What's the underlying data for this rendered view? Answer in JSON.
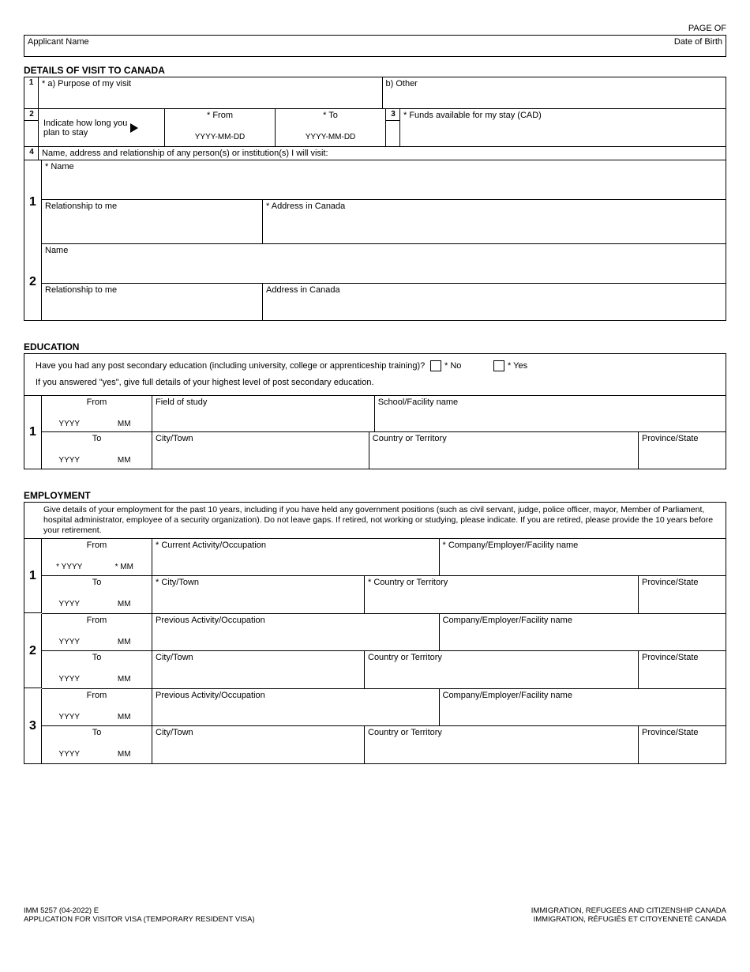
{
  "page_label": "PAGE  OF",
  "header": {
    "applicant_name": "Applicant Name",
    "dob": "Date of Birth"
  },
  "visit": {
    "title": "DETAILS OF VISIT TO CANADA",
    "n1": "1",
    "purpose": "* a) Purpose of my visit",
    "other": "b) Other",
    "n2": "2",
    "indicate": "Indicate how long you plan to stay",
    "from": "* From",
    "to": "* To",
    "date_fmt": "YYYY-MM-DD",
    "n3": "3",
    "funds": "* Funds available for my stay (CAD)",
    "n4": "4",
    "persons": "Name, address and relationship of any person(s) or institution(s) I will visit:",
    "p1": {
      "num": "1",
      "name": "* Name",
      "rel": "Relationship to me",
      "addr": "* Address in Canada"
    },
    "p2": {
      "num": "2",
      "name": "Name",
      "rel": "Relationship to me",
      "addr": "Address in Canada"
    }
  },
  "education": {
    "title": "EDUCATION",
    "q": "Have you had any post secondary education (including university, college or apprenticeship training)?",
    "no": "* No",
    "yes": "* Yes",
    "sub": "If you answered \"yes\", give full details of your highest level of post secondary education.",
    "num": "1",
    "from": "From",
    "to": "To",
    "yyyy": "YYYY",
    "mm": "MM",
    "field": "Field of study",
    "school": "School/Facility name",
    "city": "City/Town",
    "country": "Country or Territory",
    "prov": "Province/State"
  },
  "employment": {
    "title": "EMPLOYMENT",
    "instr": "Give details of your employment for the past 10 years, including if you have held any government positions (such as civil servant, judge, police officer, mayor, Member of Parliament, hospital administrator, employee of a security organization).  Do not leave gaps.  If retired, not working or studying, please indicate.  If you are retired, please provide the 10 years before your retirement.",
    "from": "From",
    "to": "To",
    "yyyy": "YYYY",
    "mm": "MM",
    "yyyy_r": "* YYYY",
    "mm_r": "* MM",
    "rows": [
      {
        "num": "1",
        "act": "* Current Activity/Occupation",
        "emp": "* Company/Employer/Facility name",
        "city": "* City/Town",
        "country": "* Country or Territory",
        "prov": "Province/State"
      },
      {
        "num": "2",
        "act": "Previous Activity/Occupation",
        "emp": "Company/Employer/Facility name",
        "city": "City/Town",
        "country": "Country or Territory",
        "prov": "Province/State"
      },
      {
        "num": "3",
        "act": "Previous Activity/Occupation",
        "emp": "Company/Employer/Facility name",
        "city": "City/Town",
        "country": "Country or Territory",
        "prov": "Province/State"
      }
    ]
  },
  "footer": {
    "form": "IMM 5257 (04-2022) E",
    "app": "APPLICATION FOR VISITOR VISA (TEMPORARY RESIDENT VISA)",
    "en": "IMMIGRATION, REFUGEES AND CITIZENSHIP CANADA",
    "fr": "IMMIGRATION, RÉFUGIÉS ET CITOYENNETÉ CANADA"
  }
}
